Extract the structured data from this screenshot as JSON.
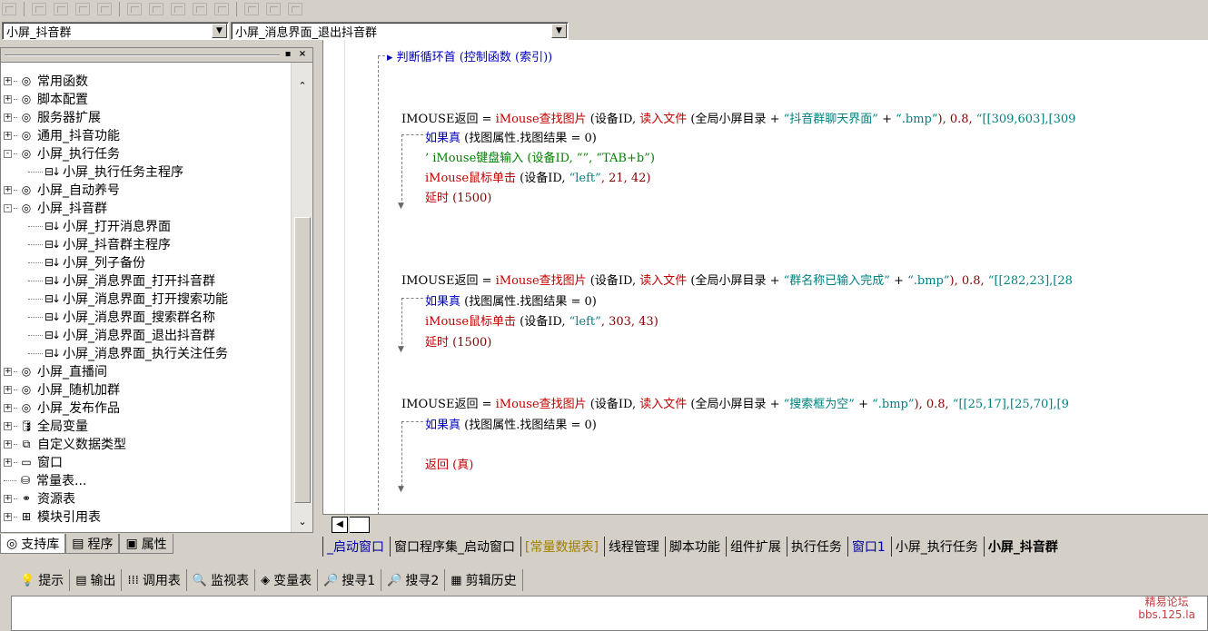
{
  "combos": {
    "left": "小屏_抖音群",
    "right": "小屏_消息界面_退出抖音群"
  },
  "tree": [
    {
      "label": "常用函数",
      "kind": "lib",
      "expand": "+"
    },
    {
      "label": "脚本配置",
      "kind": "lib",
      "expand": "+"
    },
    {
      "label": "服务器扩展",
      "kind": "lib",
      "expand": "+"
    },
    {
      "label": "通用_抖音功能",
      "kind": "lib",
      "expand": "+"
    },
    {
      "label": "小屏_执行任务",
      "kind": "lib",
      "expand": "-"
    },
    {
      "label": "小屏_执行任务主程序",
      "kind": "sub",
      "expand": ""
    },
    {
      "label": "小屏_自动养号",
      "kind": "lib",
      "expand": "+"
    },
    {
      "label": "小屏_抖音群",
      "kind": "lib",
      "expand": "-"
    },
    {
      "label": "小屏_打开消息界面",
      "kind": "sub",
      "expand": ""
    },
    {
      "label": "小屏_抖音群主程序",
      "kind": "sub",
      "expand": ""
    },
    {
      "label": "小屏_列子备份",
      "kind": "sub",
      "expand": ""
    },
    {
      "label": "小屏_消息界面_打开抖音群",
      "kind": "sub",
      "expand": ""
    },
    {
      "label": "小屏_消息界面_打开搜索功能",
      "kind": "sub",
      "expand": ""
    },
    {
      "label": "小屏_消息界面_搜索群名称",
      "kind": "sub",
      "expand": ""
    },
    {
      "label": "小屏_消息界面_退出抖音群",
      "kind": "sub",
      "expand": ""
    },
    {
      "label": "小屏_消息界面_执行关注任务",
      "kind": "sub",
      "expand": ""
    },
    {
      "label": "小屏_直播间",
      "kind": "lib",
      "expand": "+"
    },
    {
      "label": "小屏_随机加群",
      "kind": "lib",
      "expand": "+"
    },
    {
      "label": "小屏_发布作品",
      "kind": "lib",
      "expand": "+"
    },
    {
      "label": "全局变量",
      "kind": "var",
      "expand": "+"
    },
    {
      "label": "自定义数据类型",
      "kind": "type",
      "expand": "+"
    },
    {
      "label": "窗口",
      "kind": "win",
      "expand": "+"
    },
    {
      "label": "常量表...",
      "kind": "const",
      "expand": ""
    },
    {
      "label": "资源表",
      "kind": "res",
      "expand": "+"
    },
    {
      "label": "模块引用表",
      "kind": "mod",
      "expand": "+"
    }
  ],
  "left_tabs": [
    "支持库",
    "程序",
    "属性"
  ],
  "code": {
    "line_top": "判断循环首 (控制函数 (索引))",
    "b1_a1": "IMOUSE返回 = ",
    "b1_a2": "iMouse查找图片",
    "b1_a3": " (设备ID, ",
    "b1_a4": "读入文件",
    "b1_a5": " (全局小屏目录 + ",
    "b1_a6": "“抖音群聊天界面”",
    "b1_a7": " + ",
    "b1_a8": "“.bmp”",
    "b1_a9": "), 0.8, ",
    "b1_a10": "“[[309,603],[309",
    "b1_if": "如果真",
    "b1_if2": " (找图属性.找图结果 = 0)",
    "b1_c1": "’ iMouse键盘输入 (设备ID, “”, “TAB+b”)",
    "b1_c2a": "iMouse鼠标单击",
    "b1_c2b": " (设备ID, ",
    "b1_c2c": "“left”",
    "b1_c2d": ", 21, 42)",
    "b1_c3a": "延时",
    "b1_c3b": " (1500)",
    "b2_a6": "“群名称已输入完成”",
    "b2_a10": "“[[282,23],[28",
    "b2_c2d": ", 303, 43)",
    "b3_a6": "“搜索框为空”",
    "b3_a10": "“[[25,17],[25,70],[9",
    "b3_ret": "返回 (真)"
  },
  "file_tabs": [
    "_启动窗口",
    "窗口程序集_启动窗口",
    "[常量数据表]",
    "线程管理",
    "脚本功能",
    "组件扩展",
    "执行任务",
    "窗口1",
    "小屏_执行任务",
    "小屏_抖音群"
  ],
  "output_tabs": [
    "提示",
    "输出",
    "调用表",
    "监视表",
    "变量表",
    "搜寻1",
    "搜寻2",
    "剪辑历史"
  ],
  "watermark": {
    "line1": "精易论坛",
    "line2": "bbs.125.la"
  }
}
